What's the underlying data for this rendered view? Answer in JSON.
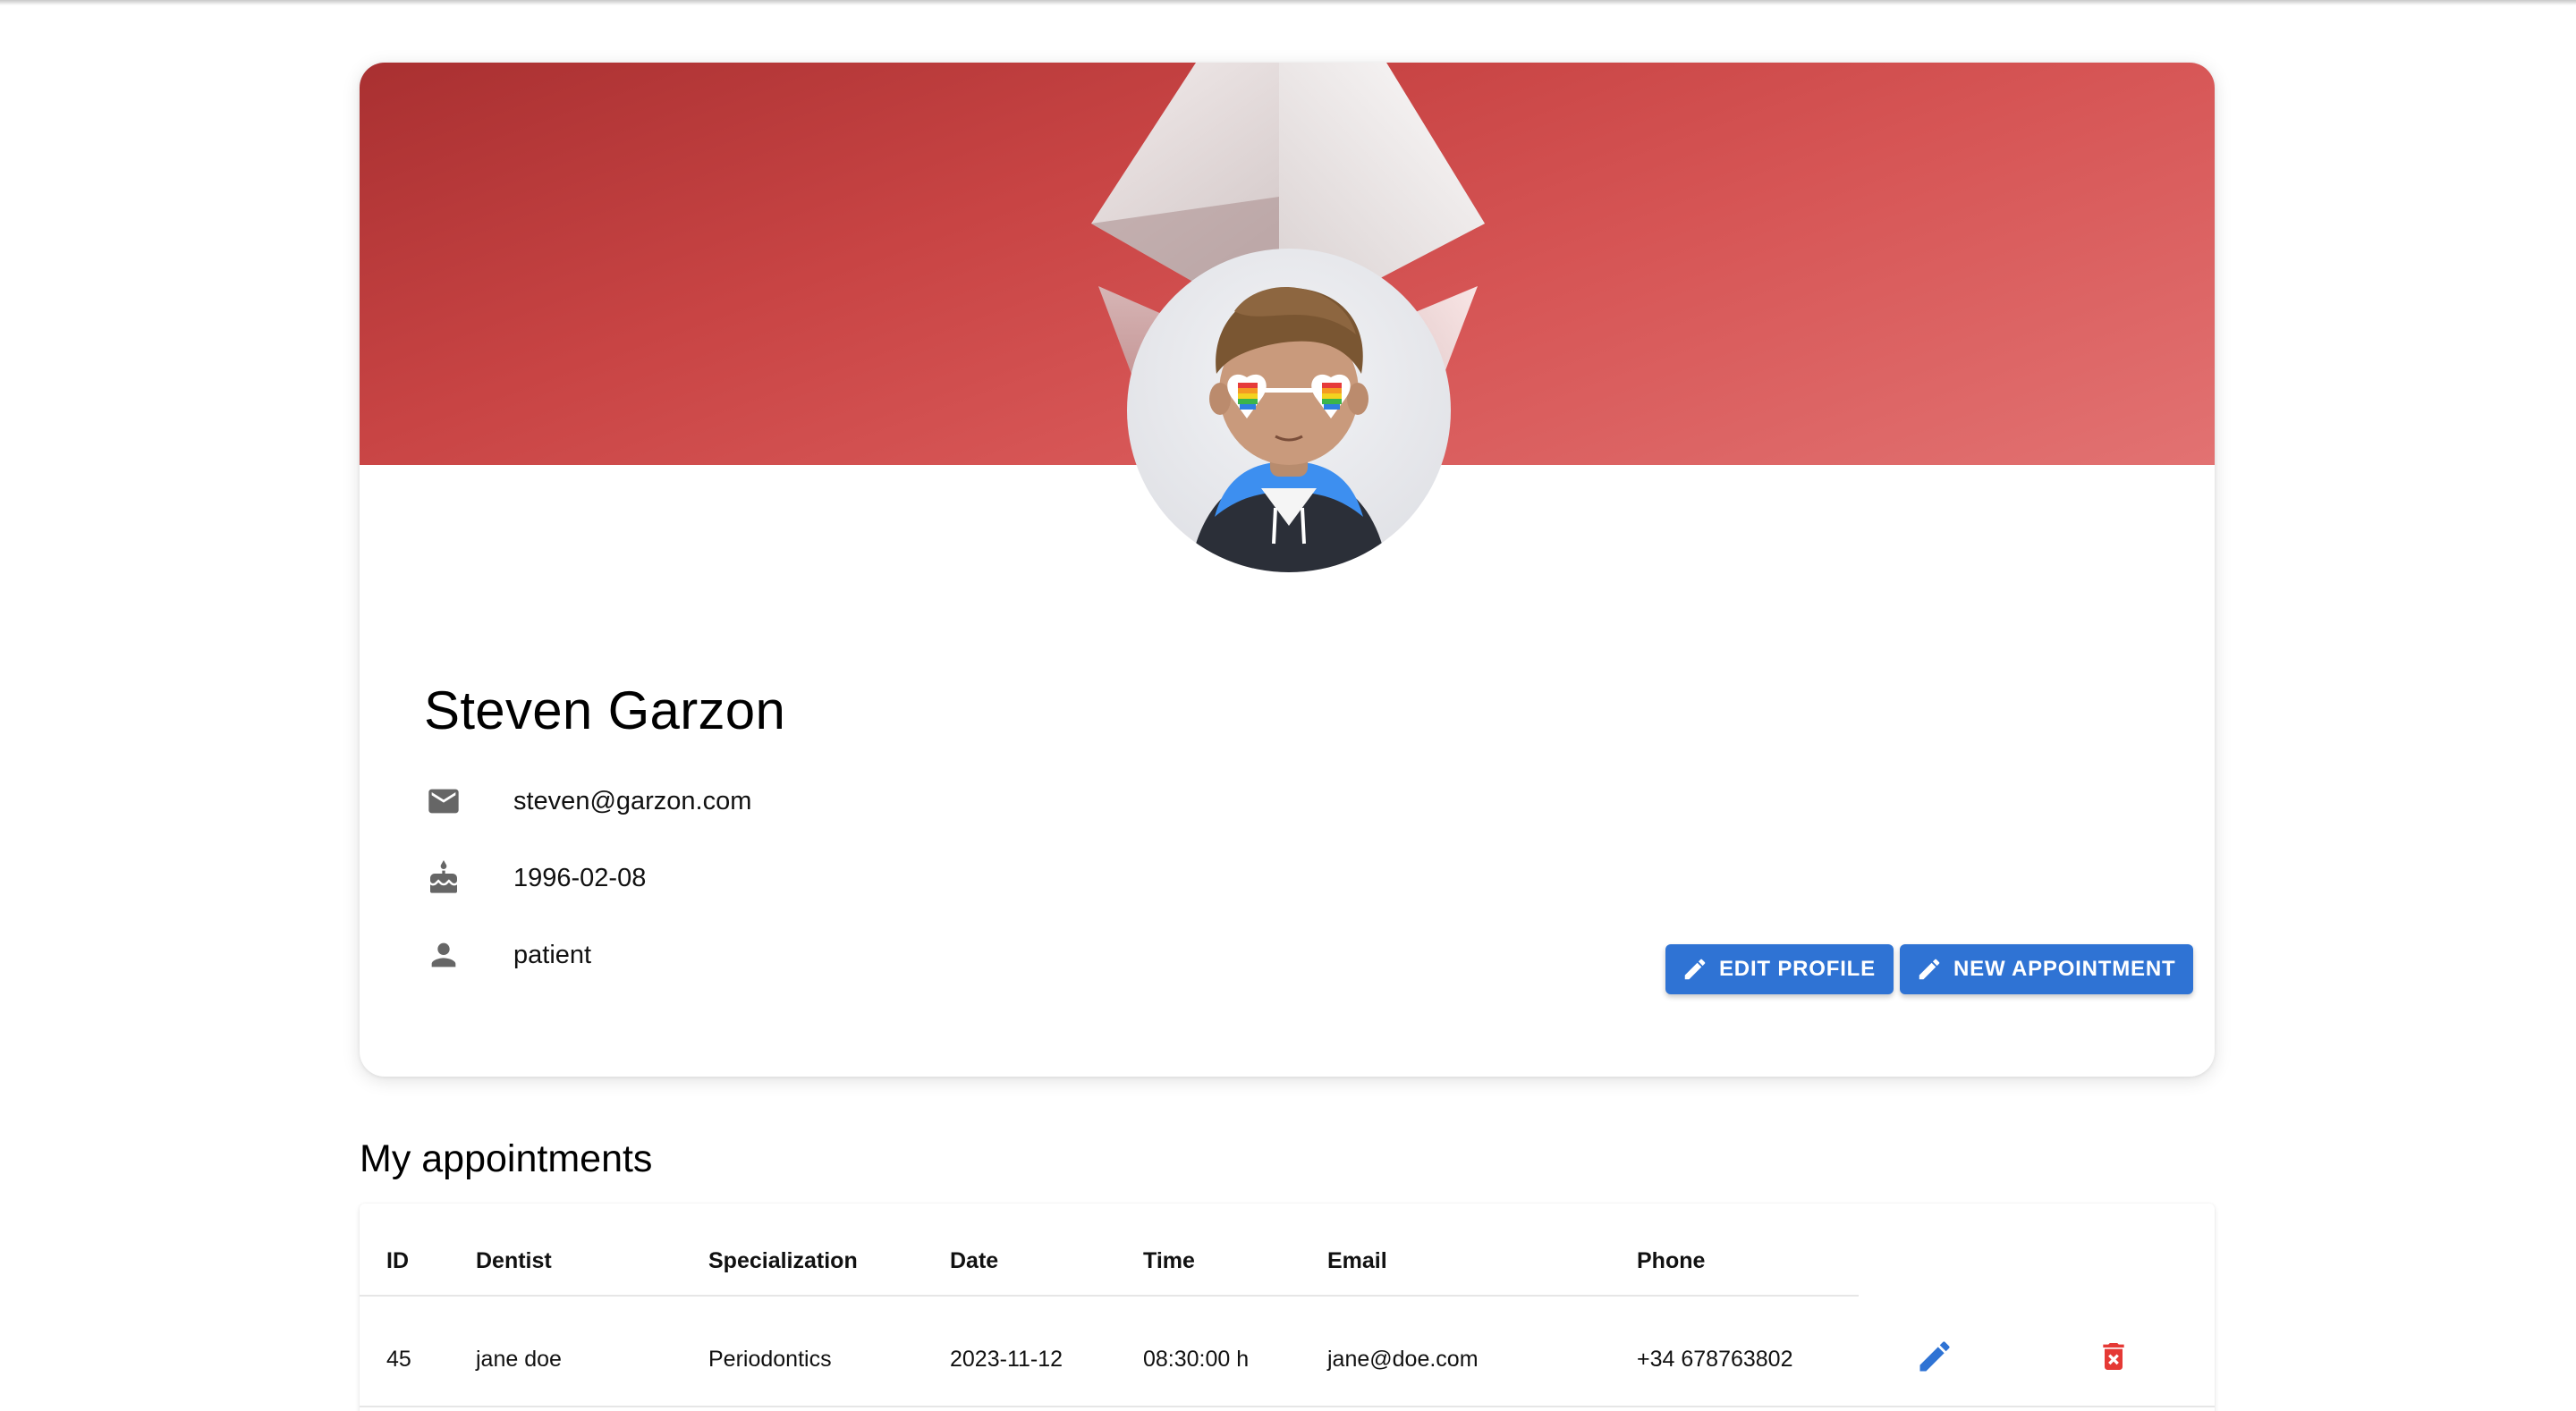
{
  "profile": {
    "name": "Steven Garzon",
    "email": "steven@garzon.com",
    "birthdate": "1996-02-08",
    "role": "patient",
    "email_icon": "mail-icon",
    "birthdate_icon": "cake-icon",
    "role_icon": "person-icon"
  },
  "actions": {
    "edit_profile": "EDIT PROFILE",
    "new_appointment": "NEW APPOINTMENT",
    "icon": "pencil-icon"
  },
  "appointments": {
    "title": "My appointments",
    "columns": [
      "ID",
      "Dentist",
      "Specialization",
      "Date",
      "Time",
      "Email",
      "Phone"
    ],
    "rows": [
      {
        "id": "45",
        "dentist": "jane doe",
        "specialization": "Periodontics",
        "date": "2023-11-12",
        "time": "08:30:00 h",
        "email": "jane@doe.com",
        "phone": "+34 678763802",
        "edit_icon": "pencil-icon",
        "delete_icon": "trash-icon"
      }
    ]
  },
  "colors": {
    "primary": "#2f73d4",
    "danger": "#e53935",
    "cover_red": "#c84444"
  }
}
